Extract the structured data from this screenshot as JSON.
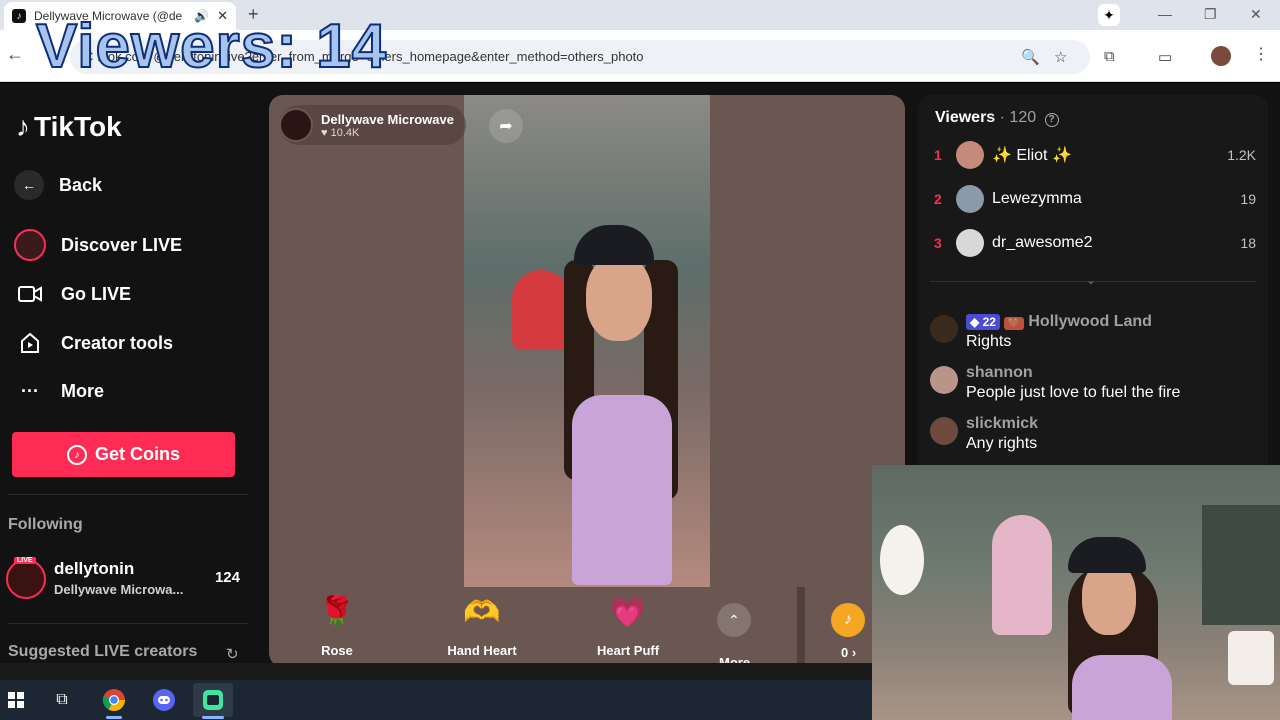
{
  "browser": {
    "tab_title": "Dellywave Microwave (@de",
    "url_text": "Viewers/live?enter_from_merge=others_homepage&enter_method=others_photo",
    "url_text_visible": "C  ...ok.com/@dellytonin/live?enter_from_merge=others_homepage&enter_method=others_photo"
  },
  "overlay": {
    "viewers_text": "Viewers: 14"
  },
  "sidebar": {
    "logo_text": "TikTok",
    "nav": [
      {
        "label": "Back",
        "icon": "back-arrow-icon"
      },
      {
        "label": "Discover LIVE",
        "icon": "live-avatar-icon"
      },
      {
        "label": "Go LIVE",
        "icon": "video-camera-icon"
      },
      {
        "label": "Creator tools",
        "icon": "creator-tools-icon"
      },
      {
        "label": "More",
        "icon": "more-dots-icon"
      }
    ],
    "get_coins": "Get Coins",
    "following_title": "Following",
    "following": [
      {
        "name": "dellytonin",
        "sub": "Dellywave Microwa...",
        "count": "124",
        "badge": "LIVE"
      }
    ],
    "suggested_title": "Suggested LIVE creators"
  },
  "stream": {
    "host_name": "Dellywave Microwave",
    "host_likes": "♥ 10.4K",
    "gifts": [
      {
        "label": "Rose",
        "icon": "rose-icon",
        "glyph": "🌹"
      },
      {
        "label": "Hand Heart",
        "icon": "hand-heart-icon",
        "glyph": "🫶"
      },
      {
        "label": "Heart Puff",
        "icon": "heart-puff-icon",
        "glyph": "💗"
      }
    ],
    "more_label": "More",
    "coin_count": "0 ›"
  },
  "viewers_panel": {
    "title": "Viewers",
    "count": "· 120",
    "top": [
      {
        "rank": "1",
        "name": "✨ Eliot ✨",
        "score": "1.2K",
        "avatar_color": "#c48a7a"
      },
      {
        "rank": "2",
        "name": "Lewezymma",
        "score": "19",
        "avatar_color": "#8a9aa8"
      },
      {
        "rank": "3",
        "name": "dr_awesome2",
        "score": "18",
        "avatar_color": "#d8d8d8"
      }
    ],
    "chat": [
      {
        "user": "Hollywood Land",
        "level": "22",
        "fan": "🤎",
        "msg": "Rights",
        "avatar_color": "#3a2a1e"
      },
      {
        "user": "shannon",
        "msg": "People just love to fuel the fire",
        "avatar_color": "#b8948a"
      },
      {
        "user": "slickmick",
        "msg": "Any rights",
        "avatar_color": "#6e4a3e"
      }
    ]
  },
  "colors": {
    "accent": "#fe2c55",
    "page_bg": "#121212",
    "overlay_text": "#a9c4ec"
  }
}
